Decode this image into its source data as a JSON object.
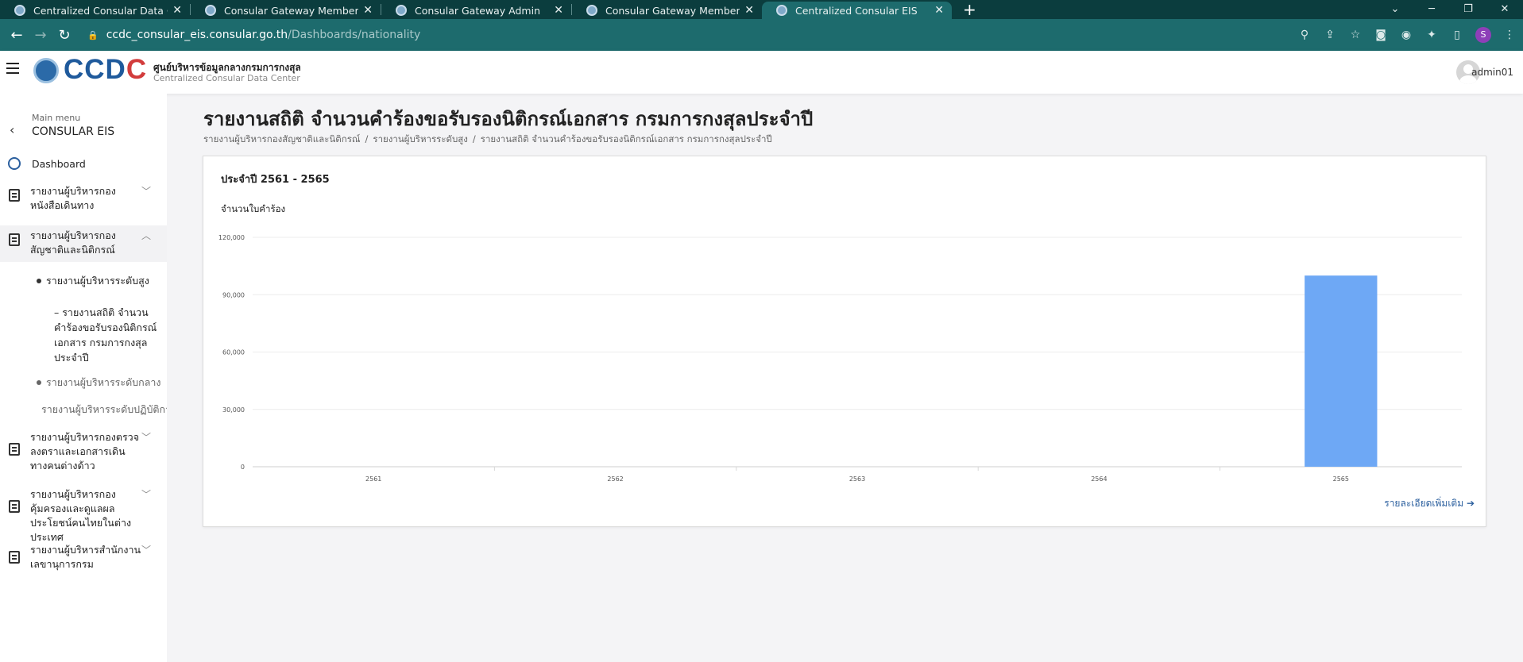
{
  "browser": {
    "tabs": [
      {
        "label": "Centralized Consular Data Center",
        "active": false
      },
      {
        "label": "Consular Gateway Member Portal",
        "active": false
      },
      {
        "label": "Consular Gateway Admin",
        "active": false
      },
      {
        "label": "Consular Gateway Member Portal",
        "active": false
      },
      {
        "label": "Centralized Consular EIS",
        "active": true
      }
    ],
    "url_host": "ccdc_consular_eis.consular.go.th",
    "url_path": "/Dashboards/nationality",
    "profile_initial": "S"
  },
  "header": {
    "logo_text_prefix": "CCD",
    "logo_text_suffix": "C",
    "org_name_th": "ศูนย์บริหารข้อมูลกลางกรมการกงสุล",
    "org_name_en": "Centralized Consular Data Center",
    "username": "admin01"
  },
  "sidebar": {
    "main_menu_label": "Main menu",
    "main_menu_title": "CONSULAR EIS",
    "dashboard_label": "Dashboard",
    "items": [
      {
        "label": "รายงานผู้บริหารกองหนังสือเดินทาง"
      },
      {
        "label": "รายงานผู้บริหารกองสัญชาติและนิติกรณ์"
      },
      {
        "label": "รายงานผู้บริหารกองตรวจลงตราและเอกสารเดินทางคนต่างด้าว"
      },
      {
        "label": "รายงานผู้บริหารกองคุ้มครองและดูแลผลประโยชน์คนไทยในต่างประเทศ"
      },
      {
        "label": "รายงานผู้บริหารสำนักงานเลขานุการกรม"
      }
    ],
    "sub_items": [
      {
        "label": "รายงานผู้บริหารระดับสูง"
      },
      {
        "label": "รายงานผู้บริหารระดับกลาง"
      },
      {
        "label": "รายงานผู้บริหารระดับปฏิบัติการ"
      }
    ],
    "active_report": "– รายงานสถิติ จำนวนคำร้องขอรับรองนิติกรณ์เอกสาร กรมการกงสุลประจำปี"
  },
  "main": {
    "page_title": "รายงานสถิติ จำนวนคำร้องขอรับรองนิติกรณ์เอกสาร กรมการกงสุลประจำปี",
    "breadcrumb": [
      "รายงานผู้บริหารกองสัญชาติและนิติกรณ์",
      "รายงานผู้บริหารระดับสูง",
      "รายงานสถิติ จำนวนคำร้องขอรับรองนิติกรณ์เอกสาร กรมการกงสุลประจำปี"
    ],
    "card_title": "ประจำปี 2561 - 2565",
    "more_link": "รายละเอียดเพิ่มเติม ➔"
  },
  "chart_data": {
    "type": "bar",
    "categories": [
      "2561",
      "2562",
      "2563",
      "2564",
      "2565"
    ],
    "values": [
      0,
      0,
      0,
      0,
      100000
    ],
    "ylabel": "จำนวนใบคำร้อง",
    "ylim": [
      0,
      120000
    ],
    "yticks": [
      "0",
      "30,000",
      "60,000",
      "90,000",
      "120,000"
    ],
    "bar_color": "#6ea8f5",
    "grid": true
  }
}
